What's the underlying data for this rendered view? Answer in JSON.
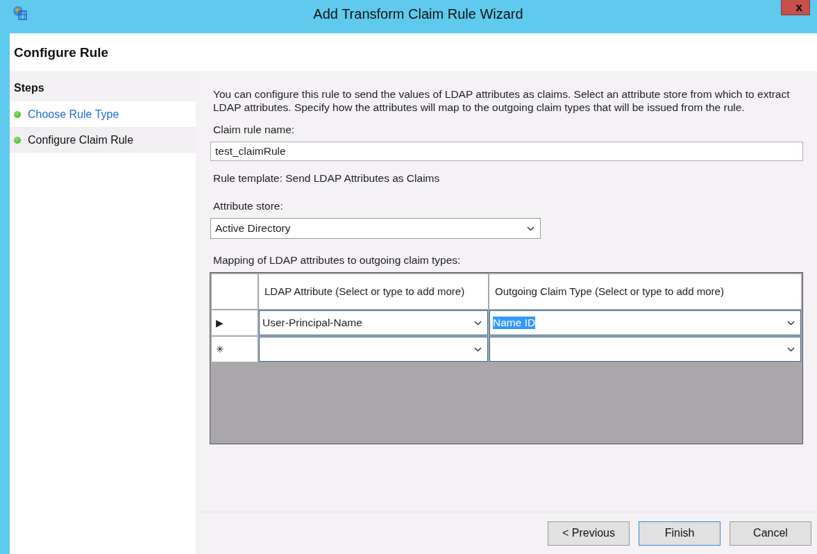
{
  "window": {
    "title": "Add Transform Claim Rule Wizard",
    "close": "x"
  },
  "page_title": "Configure Rule",
  "steps": {
    "title": "Steps",
    "items": [
      {
        "label": "Choose Rule Type",
        "kind": "link",
        "selected": false
      },
      {
        "label": "Configure Claim Rule",
        "kind": "current",
        "selected": true
      }
    ]
  },
  "description": "You can configure this rule to send the values of LDAP attributes as claims. Select an attribute store from which to extract LDAP attributes. Specify how the attributes will map to the outgoing claim types that will be issued from the rule.",
  "claim_rule_name": {
    "label": "Claim rule name:",
    "value": "test_claimRule"
  },
  "rule_template": "Rule template: Send LDAP Attributes as Claims",
  "attribute_store": {
    "label": "Attribute store:",
    "value": "Active Directory"
  },
  "mapping": {
    "label": "Mapping of LDAP attributes to outgoing claim types:",
    "columns": [
      "LDAP Attribute (Select or type to add more)",
      "Outgoing Claim Type (Select or type to add more)"
    ],
    "rows": [
      {
        "marker": "▶",
        "cells": [
          {
            "value": "User-Principal-Name",
            "selected": false
          },
          {
            "value": "Name ID",
            "selected": true
          }
        ]
      },
      {
        "marker": "✳"
      }
    ]
  },
  "buttons": [
    {
      "label": "< Previous",
      "default": false
    },
    {
      "label": "Finish",
      "default": true
    },
    {
      "label": "Cancel",
      "default": false
    }
  ]
}
